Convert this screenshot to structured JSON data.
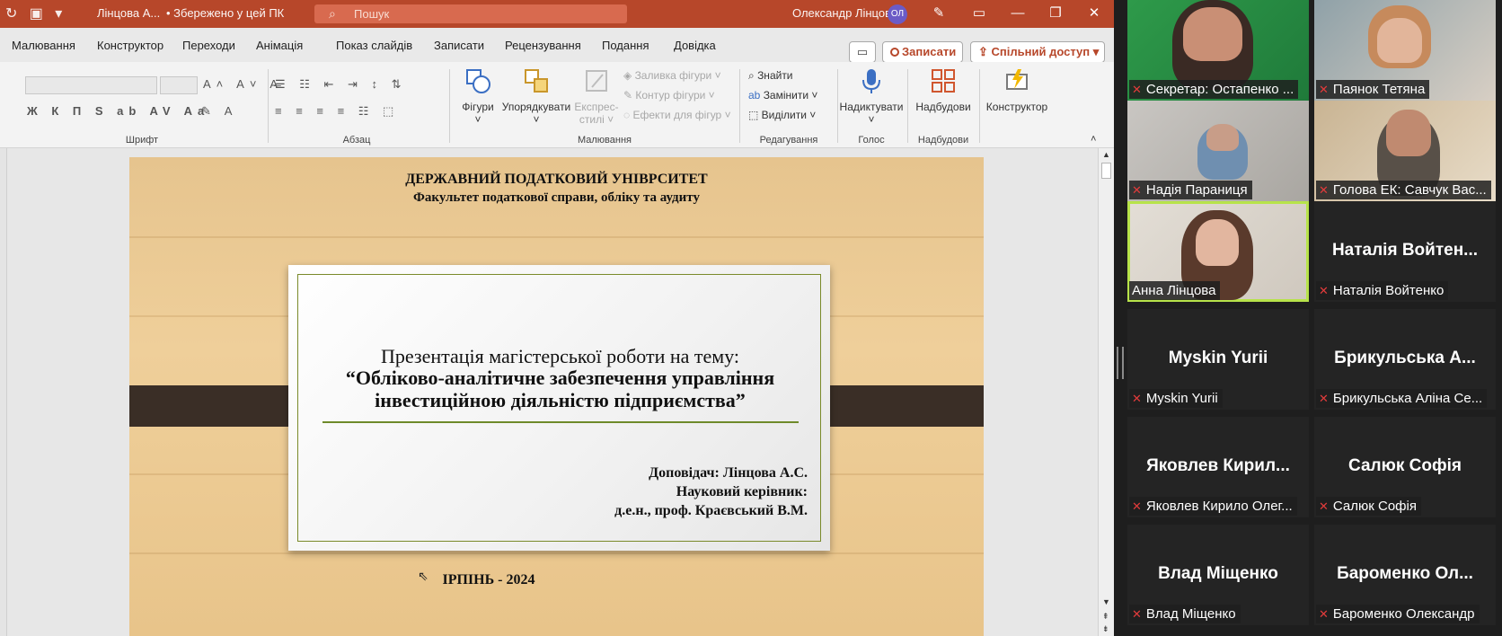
{
  "titlebar": {
    "doc_name": "Лінцова А...",
    "saved_status": "• Збережено у цей ПК",
    "search_placeholder": "Пошук",
    "user_name": "Олександр Лінцов",
    "user_initials": "ОЛ"
  },
  "menu": {
    "items": [
      "Малювання",
      "Конструктор",
      "Переходи",
      "Анімація",
      "Показ слайдів",
      "Записати",
      "Рецензування",
      "Подання",
      "Довідка"
    ],
    "record_button": "Записати",
    "share_button": "Спільний доступ"
  },
  "ribbon": {
    "groups": {
      "font": "Шрифт",
      "paragraph": "Абзац",
      "drawing": "Малювання",
      "editing": "Редагування",
      "voice": "Голос",
      "addins": "Надбудови"
    },
    "buttons": {
      "shapes": "Фігури",
      "arrange": "Упорядкувати",
      "express_line1": "Експрес-",
      "express_line2": "стилі",
      "fill": "Заливка фігури",
      "outline": "Контур фігури",
      "effects": "Ефекти для фігур",
      "find": "Знайти",
      "replace": "Замінити",
      "select": "Виділити",
      "dictate": "Надиктувати",
      "addins": "Надбудови",
      "designer": "Конструктор"
    }
  },
  "slide": {
    "university": "ДЕРЖАВНИЙ ПОДАТКОВИЙ УНІВРСИТЕТ",
    "faculty": "Факультет податкової справи, обліку та аудиту",
    "intro": "Презентація магістерської роботи на тему:",
    "topic_line1": "“Обліково-аналітичне забезпечення управління",
    "topic_line2": "інвестиційною діяльністю підприємства”",
    "speaker": "Доповідач: Лінцова А.С.",
    "supervisor_label": "Науковий керівник:",
    "supervisor": "д.е.н., проф. Краєвський В.М.",
    "city_year": "ІРПІНЬ - 2024"
  },
  "participants": [
    {
      "label": "Секретар: Остапенко ...",
      "video": true
    },
    {
      "label": "Паянок Тетяна",
      "video": true
    },
    {
      "label": "Надія Параниця",
      "video": true
    },
    {
      "label": "Голова ЕК: Савчук Вас...",
      "video": true
    },
    {
      "label": "Анна Лінцова",
      "video": true,
      "active": true
    },
    {
      "big": "Наталія Войтен...",
      "label": "Наталія Войтенко"
    },
    {
      "big": "Myskin Yurii",
      "label": "Myskin Yurii"
    },
    {
      "big": "Брикульська А...",
      "label": "Брикульська Аліна Се..."
    },
    {
      "big": "Яковлев Кирил...",
      "label": "Яковлев Кирило Олег..."
    },
    {
      "big": "Салюк Софія",
      "label": "Салюк Софія"
    },
    {
      "big": "Влад Міщенко",
      "label": "Влад Міщенко"
    },
    {
      "big": "Бароменко Ол...",
      "label": "Бароменко Олександр"
    }
  ],
  "colors": {
    "titlebar": "#b7472a",
    "slide_wood": "#efcf9a",
    "active_speaker": "#b7e34a",
    "muted_mic": "#e23b3b"
  }
}
